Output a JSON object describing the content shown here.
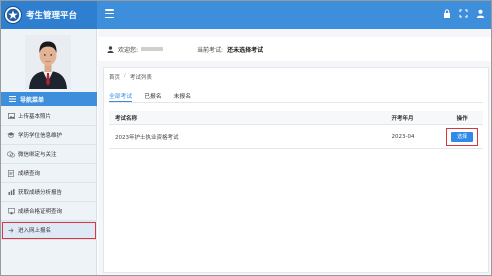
{
  "app": {
    "title": "考生管理平台"
  },
  "header": {
    "menu_icon": "hamburger-icon",
    "icons": [
      "lock-icon",
      "fullscreen-icon",
      "user-icon"
    ]
  },
  "sidebar": {
    "nav_header": "导航菜单",
    "items": [
      {
        "label": "上传基本照片",
        "icon": "image-icon"
      },
      {
        "label": "学历学位信息维护",
        "icon": "education-icon"
      },
      {
        "label": "微信绑定与关注",
        "icon": "wechat-icon"
      },
      {
        "label": "成绩查询",
        "icon": "document-icon"
      },
      {
        "label": "获取成绩分析报告",
        "icon": "chart-icon"
      },
      {
        "label": "成绩合格证明查询",
        "icon": "certificate-icon"
      },
      {
        "label": "进入网上报名",
        "icon": "enter-icon"
      }
    ]
  },
  "info": {
    "welcome_label": "欢迎您:",
    "current_exam_label": "当前考试:",
    "current_exam_value": "还未选择考试"
  },
  "breadcrumb": [
    "首页",
    "考试列表"
  ],
  "tabs": [
    "全部考试",
    "已报名",
    "未报名"
  ],
  "table": {
    "columns": [
      "考试名称",
      "开考年月",
      "操作"
    ],
    "rows": [
      {
        "name": "2023年护士执业资格考试",
        "date": "2023-04",
        "action": "选择"
      }
    ]
  },
  "colors": {
    "brand": "#3d8fdc",
    "highlight": "#d9363e",
    "button": "#2f8be6"
  }
}
